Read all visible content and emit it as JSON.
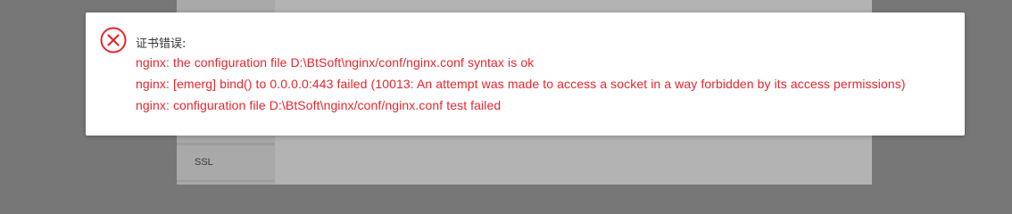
{
  "background_panel": {
    "nav_items": [
      {
        "label": "SSL"
      }
    ]
  },
  "dialog": {
    "icon": "error-circle-x-icon",
    "title": "证书错误:",
    "messages": [
      "nginx: the configuration file D:\\BtSoft\\nginx/conf/nginx.conf syntax is ok",
      "nginx: [emerg] bind() to 0.0.0.0:443 failed (10013: An attempt was made to access a socket in a way forbidden by its access permissions)",
      "nginx: configuration file D:\\BtSoft\\nginx/conf/nginx.conf test failed"
    ]
  },
  "colors": {
    "overlay": "#777777",
    "error_text": "#e8262d",
    "error_icon": "#e8262d",
    "dialog_bg": "#ffffff"
  }
}
